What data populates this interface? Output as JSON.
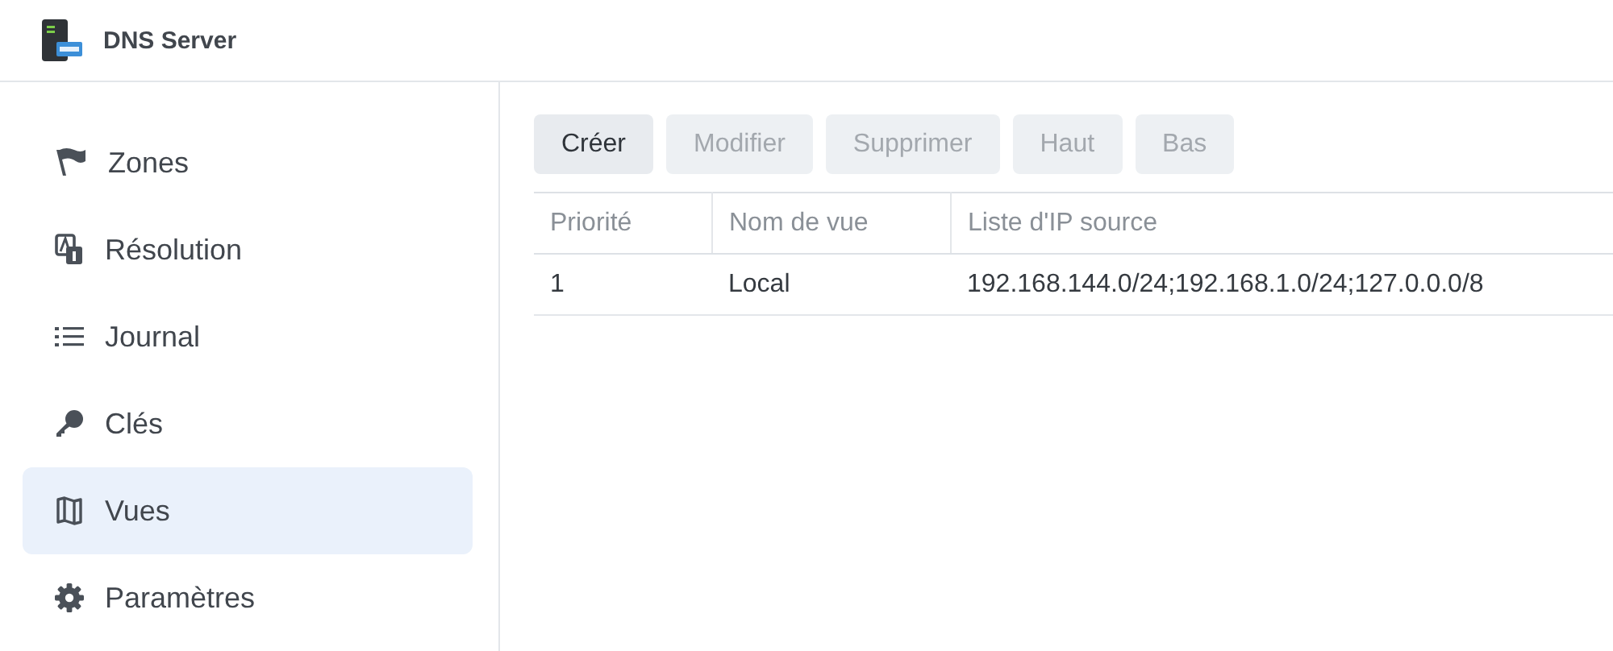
{
  "window": {
    "title": "DNS Server"
  },
  "sidebar": {
    "items": [
      {
        "label": "Zones",
        "selected": false
      },
      {
        "label": "Résolution",
        "selected": false
      },
      {
        "label": "Journal",
        "selected": false
      },
      {
        "label": "Clés",
        "selected": false
      },
      {
        "label": "Vues",
        "selected": true
      },
      {
        "label": "Paramètres",
        "selected": false
      }
    ]
  },
  "toolbar": {
    "buttons": [
      {
        "label": "Créer",
        "disabled": false
      },
      {
        "label": "Modifier",
        "disabled": true
      },
      {
        "label": "Supprimer",
        "disabled": true
      },
      {
        "label": "Haut",
        "disabled": true
      },
      {
        "label": "Bas",
        "disabled": true
      }
    ]
  },
  "table": {
    "columns": [
      "Priorité",
      "Nom de vue",
      "Liste d'IP source"
    ],
    "rows": [
      [
        "1",
        "Local",
        "192.168.144.0/24;192.168.1.0/24;127.0.0.0/8"
      ]
    ]
  }
}
